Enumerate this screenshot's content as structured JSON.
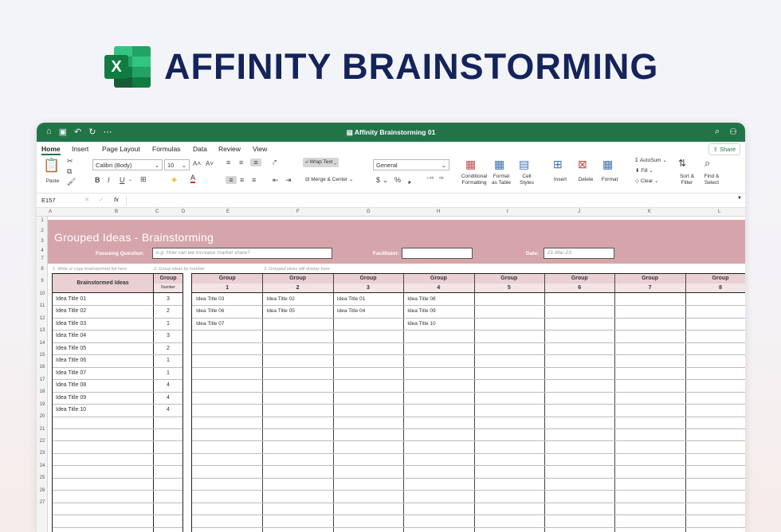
{
  "hero": {
    "badge": "X",
    "title": "AFFINITY BRAINSTORMING"
  },
  "window": {
    "title": "Affinity Brainstorming 01"
  },
  "menu": {
    "items": [
      "Home",
      "Insert",
      "Page Layout",
      "Formulas",
      "Data",
      "Review",
      "View"
    ],
    "share": "Share"
  },
  "ribbon": {
    "paste": "Paste",
    "font": "Calibri (Body)",
    "size": "10",
    "wrap_text": "Wrap Text",
    "merge_center": "Merge & Center",
    "number_format": "General",
    "conditional": [
      "Conditional",
      "Formatting"
    ],
    "format_table": [
      "Format",
      "as Table"
    ],
    "cell_styles": [
      "Cell",
      "Styles"
    ],
    "insert": "Insert",
    "delete": "Delete",
    "format": "Format",
    "autosum": "AutoSum",
    "fill": "Fill",
    "clear": "Clear",
    "sort_filter": [
      "Sort &",
      "Filter"
    ],
    "find_select": [
      "Find &",
      "Select"
    ]
  },
  "formula_bar": {
    "cell_ref": "E157",
    "fx": "fx",
    "value": ""
  },
  "columns": [
    "A",
    "B",
    "C",
    "D",
    "E",
    "F",
    "G",
    "H",
    "I",
    "J",
    "K",
    "L"
  ],
  "rows": [
    "1",
    "2",
    "3",
    "4",
    "7",
    "8",
    "9",
    "10",
    "11",
    "12",
    "13",
    "14",
    "15",
    "16",
    "17",
    "18",
    "19",
    "20",
    "21",
    "22",
    "23",
    "24",
    "25",
    "26",
    "27"
  ],
  "sheet": {
    "title": "Grouped Ideas - Brainstorming",
    "focusing_label": "Focusing Question:",
    "focusing_placeholder": "e.g. How can we increase market share?",
    "facilitator_label": "Facilitator:",
    "date_label": "Date:",
    "date_value": "21-Mar-23",
    "hint1": "1. Write or copy brainstormed list here",
    "hint2": "2. Group ideas by number",
    "hint3": "3. Grouped ideas will display here",
    "ideas_header": "Brainstormed Ideas",
    "group_header": "Group",
    "number_header": "Number",
    "ideas": [
      {
        "title": "Idea Title 01",
        "group": "3"
      },
      {
        "title": "Idea Title 02",
        "group": "2"
      },
      {
        "title": "Idea Title 03",
        "group": "1"
      },
      {
        "title": "Idea Title 04",
        "group": "3"
      },
      {
        "title": "Idea Title 05",
        "group": "2"
      },
      {
        "title": "Idea Title 06",
        "group": "1"
      },
      {
        "title": "Idea Title 07",
        "group": "1"
      },
      {
        "title": "Idea Title 08",
        "group": "4"
      },
      {
        "title": "Idea Title 09",
        "group": "4"
      },
      {
        "title": "Idea Title 10",
        "group": "4"
      }
    ],
    "groups": [
      {
        "label": "Group",
        "number": "1",
        "items": [
          "Idea Title 03",
          "Idea Title 06",
          "Idea Title 07"
        ]
      },
      {
        "label": "Group",
        "number": "2",
        "items": [
          "Idea Title 02",
          "Idea Title 05"
        ]
      },
      {
        "label": "Group",
        "number": "3",
        "items": [
          "Idea Title 01",
          "Idea Title 04"
        ]
      },
      {
        "label": "Group",
        "number": "4",
        "items": [
          "Idea Title 08",
          "Idea Title 09",
          "Idea Title 10"
        ]
      },
      {
        "label": "Group",
        "number": "5",
        "items": []
      },
      {
        "label": "Group",
        "number": "6",
        "items": []
      },
      {
        "label": "Group",
        "number": "7",
        "items": []
      },
      {
        "label": "Group",
        "number": "8",
        "items": []
      }
    ]
  }
}
